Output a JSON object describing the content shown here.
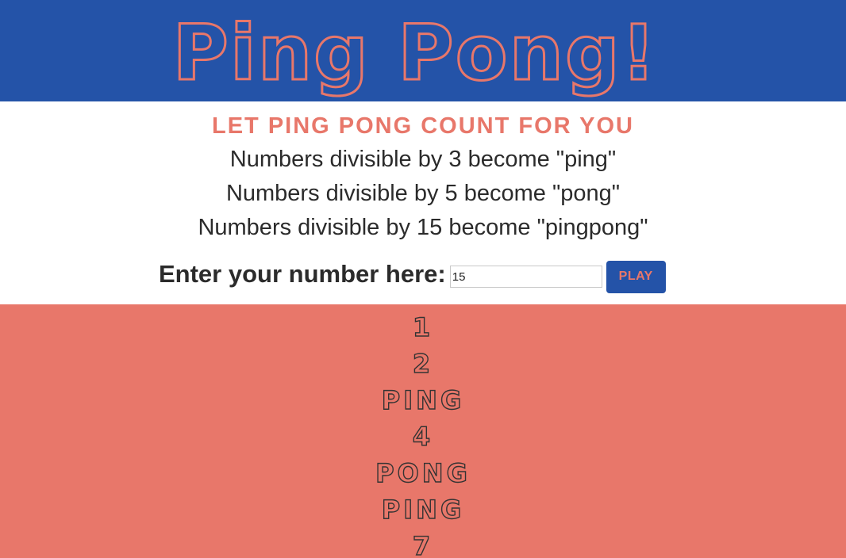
{
  "header": {
    "title": "Ping Pong!"
  },
  "intro": {
    "tagline": "LET PING PONG COUNT FOR YOU",
    "rules": [
      "Numbers divisible by 3 become \"ping\"",
      "Numbers divisible by 5 become \"pong\"",
      "Numbers divisible by 15 become \"pingpong\""
    ]
  },
  "form": {
    "label": "Enter your number here:",
    "input_value": "15",
    "button_label": "PLAY"
  },
  "results": [
    "1",
    "2",
    "PING",
    "4",
    "PONG",
    "PING",
    "7"
  ],
  "colors": {
    "header_bg": "#2453a8",
    "accent": "#e8776a",
    "text": "#2b2b2b"
  }
}
